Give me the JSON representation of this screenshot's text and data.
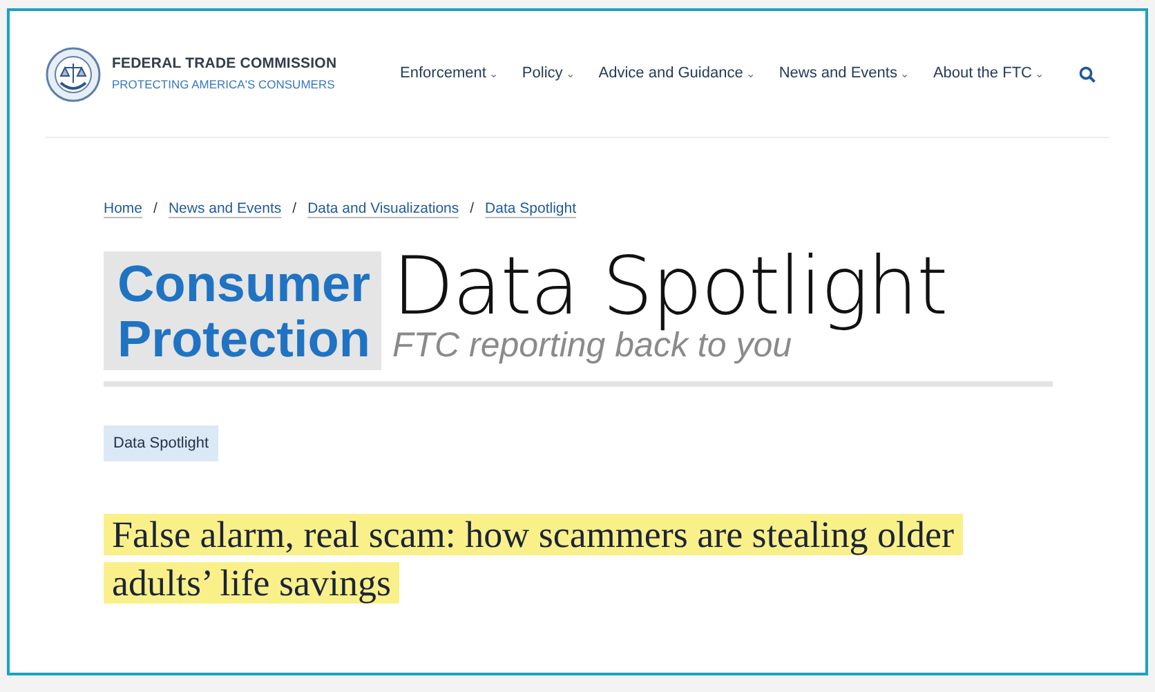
{
  "header": {
    "org_name": "FEDERAL TRADE COMMISSION",
    "tagline": "PROTECTING AMERICA'S CONSUMERS",
    "nav": [
      {
        "label": "Enforcement",
        "caret": "⌄"
      },
      {
        "label": "Policy",
        "caret": "⌄"
      },
      {
        "label": "Advice and Guidance",
        "caret": "⌄"
      },
      {
        "label": "News and Events",
        "caret": "⌄"
      },
      {
        "label": "About the FTC",
        "caret": "⌄"
      }
    ]
  },
  "breadcrumb": {
    "separator": "/",
    "items": [
      "Home",
      "News and Events",
      "Data and Visualizations",
      "Data Spotlight"
    ]
  },
  "banner": {
    "badge_lines": [
      "Consumer",
      "Protection"
    ],
    "title": "Data Spotlight",
    "subtitle": "FTC reporting back to you"
  },
  "tag": "Data Spotlight",
  "headline": "False alarm, real scam: how scammers are stealing older adults’ life savings"
}
